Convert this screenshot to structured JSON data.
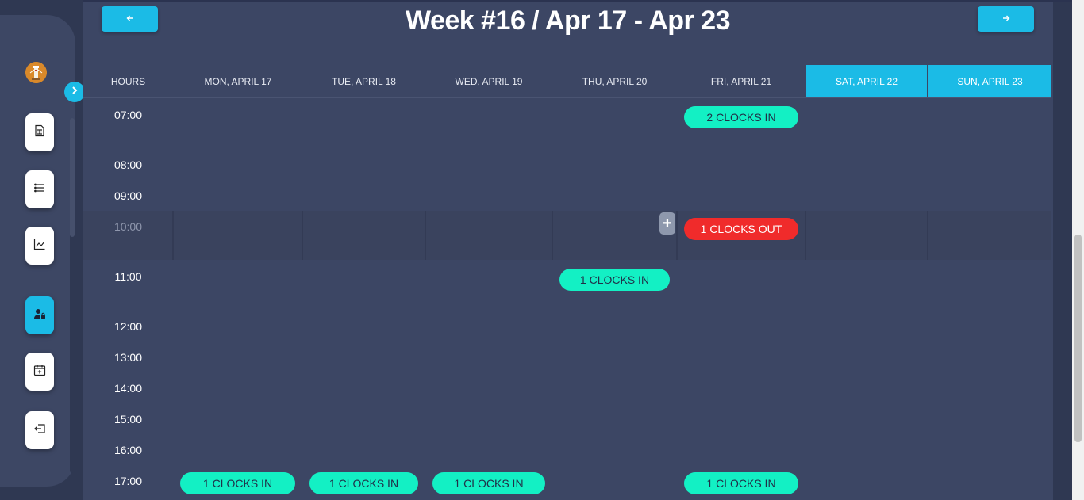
{
  "week": {
    "title": "Week #16 / Apr 17 - Apr 23",
    "prev_icon": "arrow-left-icon",
    "next_icon": "arrow-right-icon"
  },
  "sidebar": {
    "avatar_icon": "lighthouse-avatar",
    "toggle_icon": "chevron-right-icon",
    "items": [
      {
        "icon": "document-sheet-icon"
      },
      {
        "icon": "list-icon"
      },
      {
        "icon": "line-chart-icon"
      },
      {
        "icon": "user-lock-icon",
        "active": true
      },
      {
        "icon": "calendar-add-icon"
      },
      {
        "icon": "logout-icon"
      }
    ]
  },
  "calendar": {
    "hours_label": "HOURS",
    "days": [
      {
        "label": "MON, APRIL 17",
        "weekend": false
      },
      {
        "label": "TUE, APRIL 18",
        "weekend": false
      },
      {
        "label": "WED, APRIL 19",
        "weekend": false
      },
      {
        "label": "THU, APRIL 20",
        "weekend": false
      },
      {
        "label": "FRI, APRIL 21",
        "weekend": false
      },
      {
        "label": "SAT, APRIL 22",
        "weekend": true
      },
      {
        "label": "SUN, APRIL 23",
        "weekend": true
      }
    ],
    "hours": [
      "07:00",
      "08:00",
      "09:00",
      "10:00",
      "11:00",
      "12:00",
      "13:00",
      "14:00",
      "15:00",
      "16:00",
      "17:00"
    ],
    "events": [
      {
        "day": "FRI, APRIL 21",
        "hour": "07:00",
        "label": "2 CLOCKS IN",
        "kind": "in"
      },
      {
        "day": "FRI, APRIL 21",
        "hour": "10:00",
        "label": "1 CLOCKS OUT",
        "kind": "out"
      },
      {
        "day": "THU, APRIL 20",
        "hour": "11:00",
        "label": "1 CLOCKS IN",
        "kind": "in"
      },
      {
        "day": "MON, APRIL 17",
        "hour": "17:00",
        "label": "1 CLOCKS IN",
        "kind": "in"
      },
      {
        "day": "TUE, APRIL 18",
        "hour": "17:00",
        "label": "1 CLOCKS IN",
        "kind": "in"
      },
      {
        "day": "WED, APRIL 19",
        "hour": "17:00",
        "label": "1 CLOCKS IN",
        "kind": "in"
      },
      {
        "day": "FRI, APRIL 21",
        "hour": "17:00",
        "label": "1 CLOCKS IN",
        "kind": "in"
      }
    ],
    "add_button": "+"
  },
  "colors": {
    "accent": "#1bbbe6",
    "clock_in": "#13f0c4",
    "clock_out": "#f02b2b",
    "background": "#3c4664"
  }
}
